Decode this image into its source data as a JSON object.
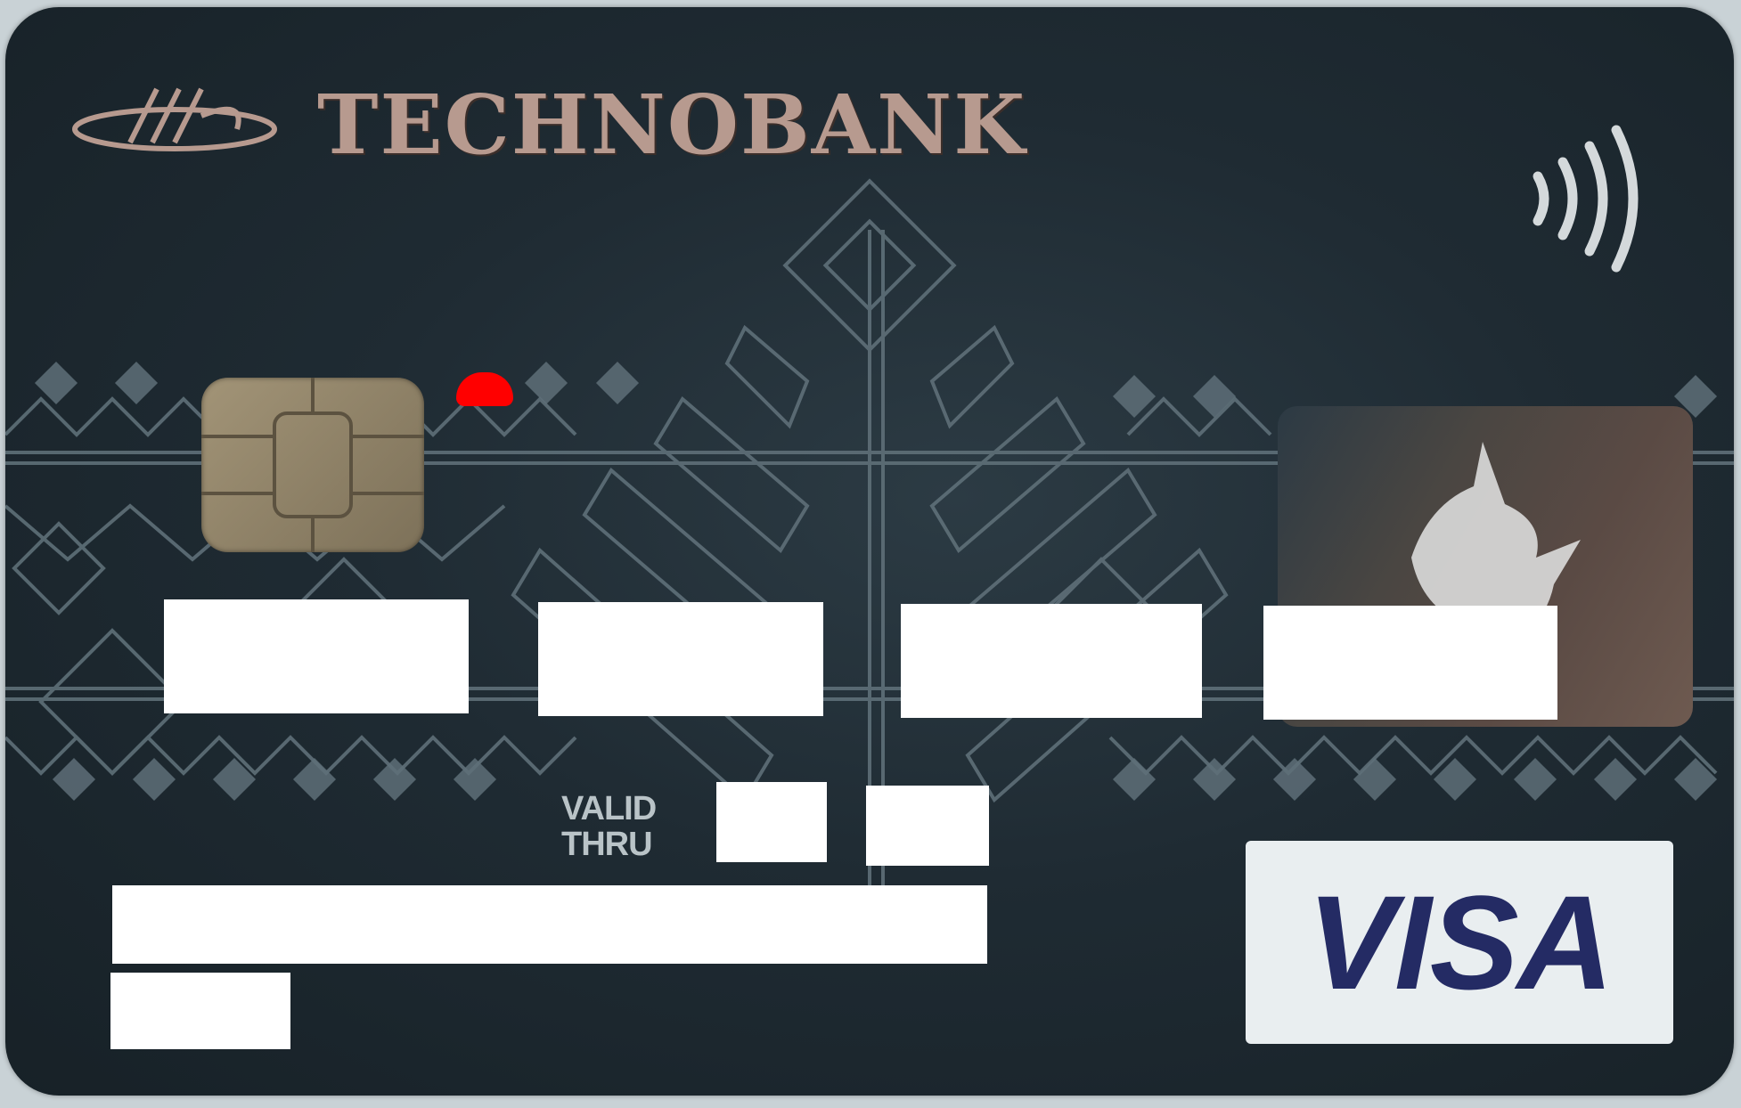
{
  "card": {
    "bank_name": "TECHNOBANK",
    "valid_label_line1": "VALID",
    "valid_label_line2": "THRU",
    "network": "VISA",
    "contactless_icon": "contactless-icon",
    "logo_icon": "bank-logo-icon",
    "hologram_icon": "dove-hologram-icon"
  },
  "colors": {
    "card_background": "#1f2b33",
    "pattern": "#5f7079",
    "bank_name": "#b79a8f",
    "visa_blue": "#242b64",
    "redaction": "#ffffff",
    "red_mark": "#ff0000"
  }
}
